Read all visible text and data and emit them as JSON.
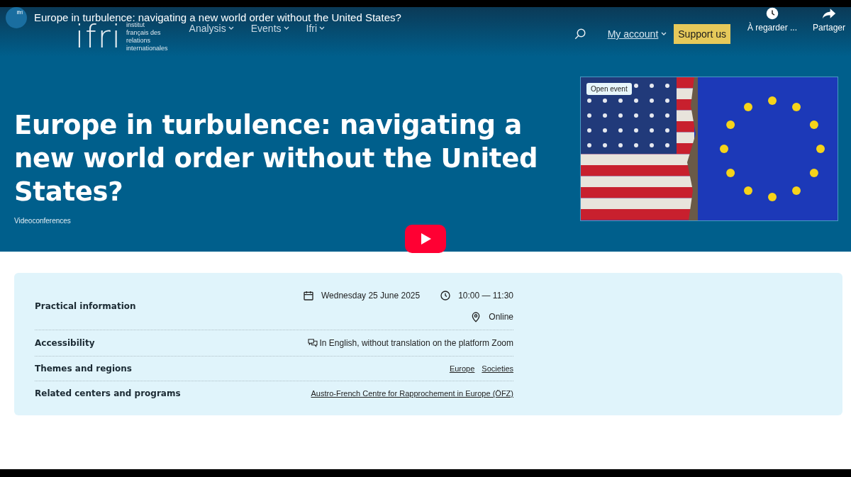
{
  "player": {
    "channel_avatar": "ifri",
    "title": "Europe in turbulence: navigating a new world order without the United States?",
    "actions": [
      {
        "kind": "watch_later",
        "label": "À regarder ..."
      },
      {
        "kind": "share",
        "label": "Partager"
      }
    ]
  },
  "site_header": {
    "logo": {
      "mark": "ifri",
      "lines": [
        "institut",
        "français des",
        "relations",
        "internationales"
      ]
    },
    "nav": [
      {
        "label": "Analysis"
      },
      {
        "label": "Events"
      },
      {
        "label": "Ifri"
      }
    ],
    "account": "My account",
    "support": "Support us"
  },
  "hero": {
    "title": "Europe in turbulence: navigating a new world order without the United States?",
    "category": "Videoconferences",
    "image": {
      "badge": "Open event"
    }
  },
  "practical": [
    {
      "kind": "schedule",
      "label": "Practical information",
      "date": "Wednesday 25 June 2025",
      "time": "10:00 — 11:30",
      "place": "Online"
    },
    {
      "kind": "text",
      "label": "Accessibility",
      "value": "In English, without translation on the platform Zoom"
    },
    {
      "kind": "links",
      "label": "Themes and regions",
      "links": [
        "Europe",
        "Societies"
      ]
    },
    {
      "kind": "links",
      "label": "Related centers and programs",
      "links": [
        "Austro-French Centre for Rapprochement in Europe (ÖFZ)"
      ]
    }
  ]
}
